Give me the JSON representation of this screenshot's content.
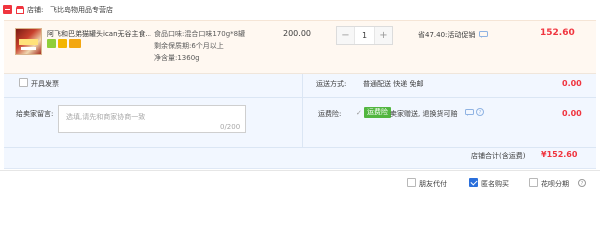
{
  "store": {
    "label": "店铺:",
    "name": "飞比岛物用品专营店"
  },
  "item": {
    "title": "阿飞和巴弟猫罐头ican无谷主食...",
    "spec_flavor": "食品口味:混合口味170g*8罐",
    "spec_shelf": "剩余保质期:6个月以上",
    "spec_net": "净含量:1360g",
    "unit_price": "200.00",
    "quantity": "1",
    "minus": "−",
    "plus": "+",
    "promo": "省47.40:活动促销",
    "subtotal": "152.60"
  },
  "invoice": {
    "label": "开具发票"
  },
  "shipping": {
    "label": "运送方式:",
    "value": "普通配送 快递 免邮",
    "fee": "0.00"
  },
  "message": {
    "label": "给卖家留言:",
    "placeholder": "选填,请先和商家协商一致",
    "counter": "0/200"
  },
  "insurance": {
    "label": "运费险:",
    "check": "✓",
    "tag": "运费险",
    "desc": "卖家赠送, 退换货可赔",
    "fee": "0.00"
  },
  "total": {
    "label": "店铺合计(含运费)",
    "value": "¥152.60"
  },
  "footer": {
    "friend_pay": "朋友代付",
    "anonymous": "匿名购买",
    "huabei": "花呗分期"
  },
  "colors": {
    "accent": "#f0353f",
    "options_bg": "#f2f7ff",
    "item_bg": "#fff8f1",
    "checked_blue": "#2a6fdb"
  }
}
